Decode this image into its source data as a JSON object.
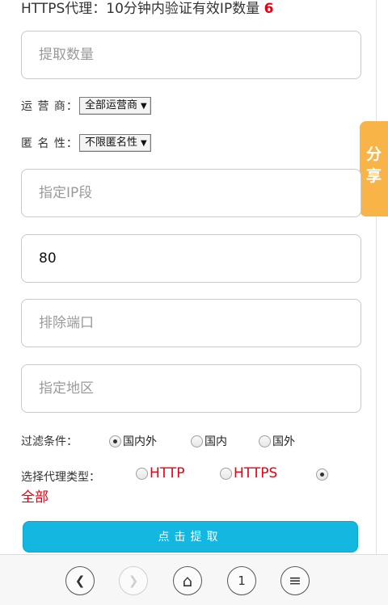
{
  "header": {
    "text": "HTTPS代理：10分钟内验证有效IP数量 ",
    "count": "6"
  },
  "fields": {
    "quantity": {
      "placeholder": "提取数量",
      "value": ""
    },
    "ip_segment": {
      "placeholder": "指定IP段",
      "value": ""
    },
    "port": {
      "placeholder": "",
      "value": "80"
    },
    "exclude_port": {
      "placeholder": "排除端口",
      "value": ""
    },
    "region": {
      "placeholder": "指定地区",
      "value": ""
    }
  },
  "carrier": {
    "label": "运 营 商：",
    "selected": "全部运营商"
  },
  "anonymity": {
    "label": "匿 名 性：",
    "selected": "不限匿名性"
  },
  "share": {
    "chars": [
      "分",
      "享"
    ]
  },
  "filter": {
    "label": "过滤条件：",
    "options": [
      {
        "label": "国内外",
        "checked": true
      },
      {
        "label": "国内",
        "checked": false
      },
      {
        "label": "国外",
        "checked": false
      }
    ]
  },
  "proxy_type": {
    "label": "选择代理类型：",
    "options": [
      {
        "label": "HTTP",
        "checked": false
      },
      {
        "label": "HTTPS",
        "checked": false
      },
      {
        "label": "全部",
        "checked": true
      }
    ],
    "accent_color": "#e60012"
  },
  "submit_label": "点击提取",
  "nav": {
    "back": "❮",
    "forward": "❯",
    "home": "⌂",
    "tabs": "1",
    "menu": "≡"
  }
}
